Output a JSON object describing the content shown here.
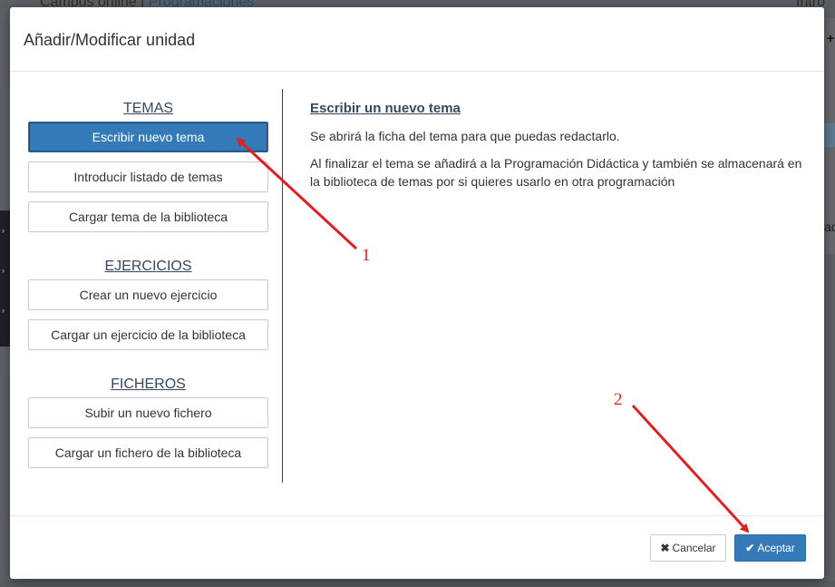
{
  "background": {
    "top_text": "Campus online",
    "top_separator": " | ",
    "top_link": "Programaciones",
    "top_right": "Intro",
    "right_text": "ac",
    "plus_glyph": "+",
    "left_glyph": "›"
  },
  "modal": {
    "title": "Añadir/Modificar unidad",
    "sections": [
      {
        "title": "TEMAS",
        "buttons": [
          "Escribir nuevo tema",
          "Introducir listado de temas",
          "Cargar tema de la biblioteca"
        ]
      },
      {
        "title": "EJERCICIOS",
        "buttons": [
          "Crear un nuevo ejercicio",
          "Cargar un ejercicio de la biblioteca"
        ]
      },
      {
        "title": "FICHEROS",
        "buttons": [
          "Subir un nuevo fichero",
          "Cargar un fichero de la biblioteca"
        ]
      }
    ],
    "selected_option": "Escribir nuevo tema",
    "description": {
      "title": "Escribir un nuevo tema",
      "p1": "Se abrirá la ficha del tema para que puedas redactarlo.",
      "p2": "Al finalizar el tema se añadirá a la Programación Didáctica y también se almacenará en la biblioteca de temas por si quieres usarlo en otra programación"
    },
    "footer": {
      "cancel_icon": "✖",
      "cancel_label": "Cancelar",
      "accept_icon": "✔",
      "accept_label": "Aceptar"
    }
  },
  "annotations": {
    "label_1": "1",
    "label_2": "2",
    "color": "#e02020"
  },
  "colors": {
    "primary": "#337ab7",
    "section_title": "#34495e"
  }
}
